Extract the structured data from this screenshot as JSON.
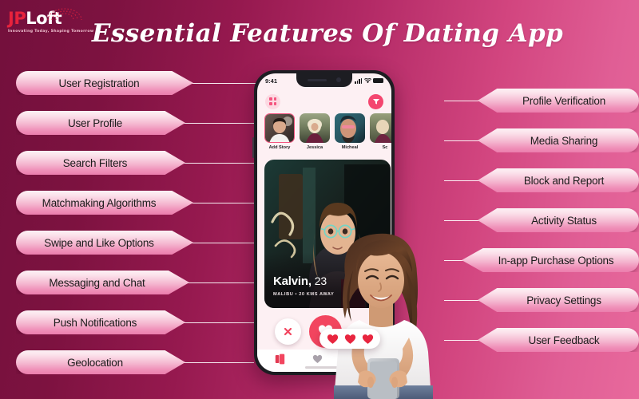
{
  "brand": {
    "name_part1": "JP",
    "name_part2": "Loft",
    "tagline": "Innovating Today, Shaping Tomorrow"
  },
  "header": {
    "title": "Essential Features Of Dating App"
  },
  "colors": {
    "bg_dark": "#7d1240",
    "bg_pink": "#e8699c",
    "pill_light": "#fdf1f5",
    "pill_deep": "#eb7dad",
    "accent_red": "#f2455f",
    "accent_pink": "#f4547f",
    "text_dark": "#1b1b1b",
    "line": "#ffffff"
  },
  "features_left": [
    {
      "label": "User Registration"
    },
    {
      "label": "User Profile"
    },
    {
      "label": "Search Filters"
    },
    {
      "label": "Matchmaking Algorithms"
    },
    {
      "label": "Swipe and Like Options"
    },
    {
      "label": "Messaging and Chat"
    },
    {
      "label": "Push Notifications"
    },
    {
      "label": "Geolocation"
    }
  ],
  "features_right": [
    {
      "label": "Profile Verification"
    },
    {
      "label": "Media Sharing"
    },
    {
      "label": "Block and Report"
    },
    {
      "label": "Activity Status"
    },
    {
      "label": "In-app Purchase Options"
    },
    {
      "label": "Privacy Settings"
    },
    {
      "label": "User Feedback"
    }
  ],
  "phone": {
    "status_bar": {
      "time": "9:41",
      "signal_icon": "signal-bars-icon",
      "wifi_icon": "wifi-icon",
      "battery_icon": "battery-icon"
    },
    "app_bar": {
      "grid_icon": "grid-menu-icon",
      "filter_icon": "filter-funnel-icon"
    },
    "stories": [
      {
        "name": "Add Story",
        "active": true
      },
      {
        "name": "Jessica",
        "active": false
      },
      {
        "name": "Micheal",
        "active": false
      },
      {
        "name": "Sc",
        "active": false
      }
    ],
    "card": {
      "name": "Kalvin,",
      "age": "23",
      "meta": "MALIBU • 20 KMS AWAY"
    },
    "actions": {
      "dislike_icon": "close-x-icon",
      "like_icon": "heart-icon"
    },
    "tabbar": [
      {
        "icon": "cards-stack-icon",
        "active": true
      },
      {
        "icon": "heart-icon",
        "active": false
      }
    ]
  },
  "overlay": {
    "hearts_count": 3,
    "heart_icon": "heart-icon"
  }
}
